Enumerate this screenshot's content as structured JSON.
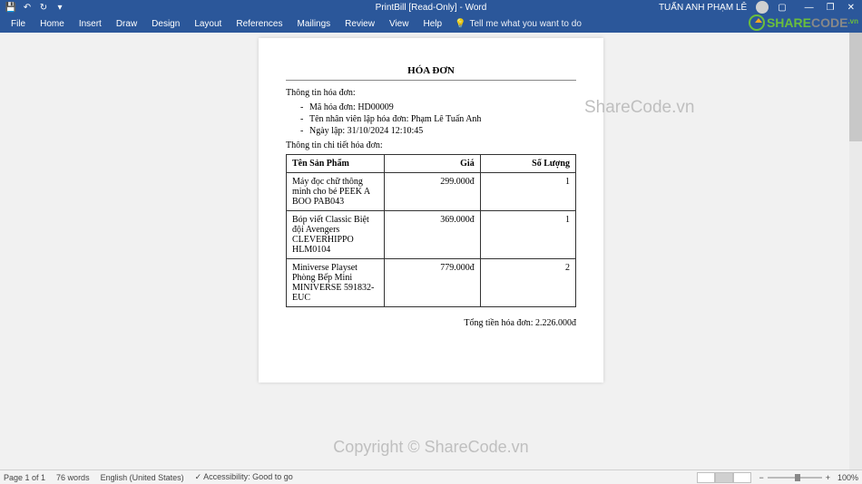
{
  "titlebar": {
    "doc_title": "PrintBill [Read-Only] - Word",
    "user_name": "TUẤN ANH PHẠM LÊ"
  },
  "tabs": [
    "File",
    "Home",
    "Insert",
    "Draw",
    "Design",
    "Layout",
    "References",
    "Mailings",
    "Review",
    "View",
    "Help"
  ],
  "tellme": "Tell me what you want to do",
  "doc": {
    "title": "HÓA ĐƠN",
    "section_info": "Thông tin hóa đơn:",
    "info_items": [
      "Mã hóa đơn: HD00009",
      "Tên nhân viên lập hóa đơn: Phạm Lê Tuấn Anh",
      "Ngày lập: 31/10/2024 12:10:45"
    ],
    "section_detail": "Thông tin chi tiết hóa đơn:",
    "headers": [
      "Tên Sản Phẩm",
      "Giá",
      "Số Lượng"
    ],
    "rows": [
      {
        "name": "Máy đọc chữ thông minh cho bé PEEK A BOO PAB043",
        "price": "299.000đ",
        "qty": "1"
      },
      {
        "name": "Bóp viết Classic Biệt đội Avengers CLEVERHIPPO HLM0104",
        "price": "369.000đ",
        "qty": "1"
      },
      {
        "name": "Miniverse Playset Phòng Bếp Mini MINIVERSE 591832-EUC",
        "price": "779.000đ",
        "qty": "2"
      }
    ],
    "total_label": "Tổng tiền hóa đơn:",
    "total_value": "2.226.000đ"
  },
  "statusbar": {
    "page": "Page 1 of 1",
    "words": "76 words",
    "lang": "English (United States)",
    "access": "Accessibility: Good to go",
    "zoom": "100%"
  },
  "watermark": {
    "side": "ShareCode.vn",
    "center": "Copyright © ShareCode.vn",
    "logo_share": "SHARE",
    "logo_code": "CODE",
    "logo_vn": ".vn"
  }
}
